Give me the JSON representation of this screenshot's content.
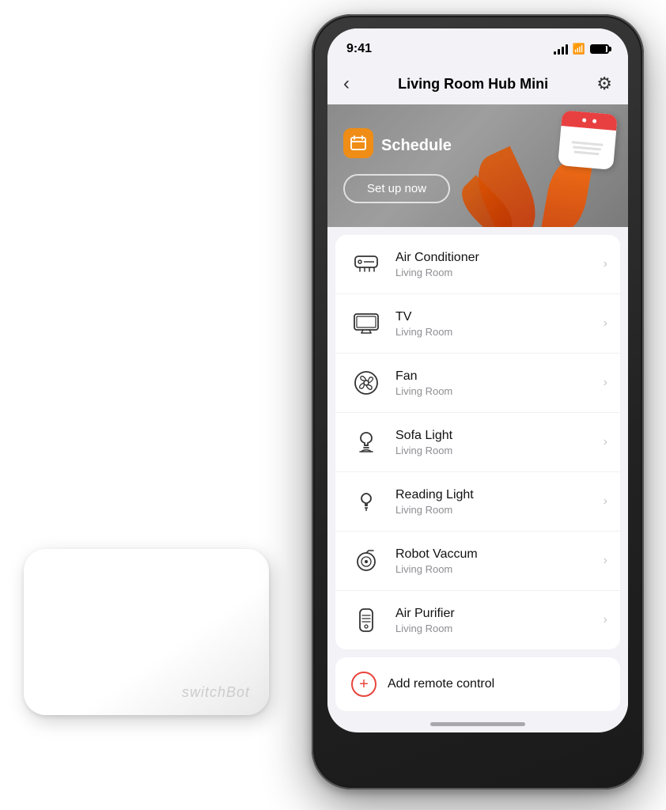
{
  "scene": {
    "background": "#ffffff"
  },
  "hub": {
    "brand": "switchBot"
  },
  "phone": {
    "status": {
      "time": "9:41"
    },
    "nav": {
      "title": "Living Room Hub Mini",
      "back_label": "‹",
      "settings_label": "⚙"
    },
    "banner": {
      "title": "Schedule",
      "setup_button": "Set up now"
    },
    "devices": [
      {
        "name": "Air Conditioner",
        "room": "Living Room",
        "icon": "ac"
      },
      {
        "name": "TV",
        "room": "Living Room",
        "icon": "tv"
      },
      {
        "name": "Fan",
        "room": "Living Room",
        "icon": "fan"
      },
      {
        "name": "Sofa Light",
        "room": "Living Room",
        "icon": "light"
      },
      {
        "name": "Reading Light",
        "room": "Living Room",
        "icon": "light2"
      },
      {
        "name": "Robot Vaccum",
        "room": "Living Room",
        "icon": "vacuum"
      },
      {
        "name": "Air Purifier",
        "room": "Living Room",
        "icon": "purifier"
      }
    ],
    "add_remote": {
      "label": "Add remote control"
    }
  }
}
